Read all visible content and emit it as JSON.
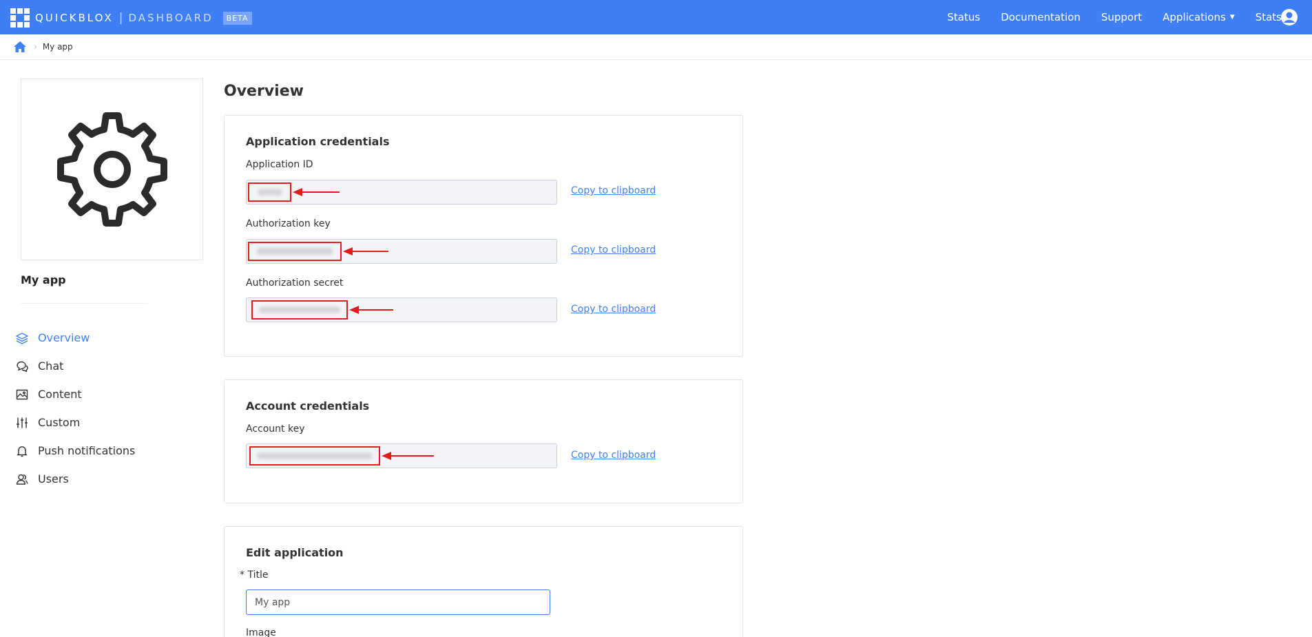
{
  "brand": {
    "name": "QUICKBLOX",
    "sub": "DASHBOARD",
    "badge": "BETA"
  },
  "nav": {
    "items": [
      "Status",
      "Documentation",
      "Support",
      "Applications",
      "Stats"
    ]
  },
  "breadcrumb": {
    "current": "My app"
  },
  "sidebar": {
    "app_name": "My app",
    "items": [
      {
        "label": "Overview",
        "icon": "layers-icon",
        "active": true
      },
      {
        "label": "Chat",
        "icon": "chat-icon"
      },
      {
        "label": "Content",
        "icon": "image-icon"
      },
      {
        "label": "Custom",
        "icon": "sliders-icon"
      },
      {
        "label": "Push notifications",
        "icon": "bell-icon"
      },
      {
        "label": "Users",
        "icon": "users-icon"
      }
    ]
  },
  "main": {
    "title": "Overview",
    "app_credentials": {
      "heading": "Application credentials",
      "fields": [
        {
          "label": "Application ID",
          "copy": "Copy to clipboard"
        },
        {
          "label": "Authorization key",
          "copy": "Copy to clipboard"
        },
        {
          "label": "Authorization secret",
          "copy": "Copy to clipboard"
        }
      ]
    },
    "account_credentials": {
      "heading": "Account credentials",
      "fields": [
        {
          "label": "Account key",
          "copy": "Copy to clipboard"
        }
      ]
    },
    "edit_application": {
      "heading": "Edit application",
      "title_required_mark": "*",
      "title_label": "Title",
      "title_value": "My app",
      "image_label": "Image"
    }
  },
  "colors": {
    "accent": "#3e7ff5",
    "annotation": "#e21b1b"
  }
}
